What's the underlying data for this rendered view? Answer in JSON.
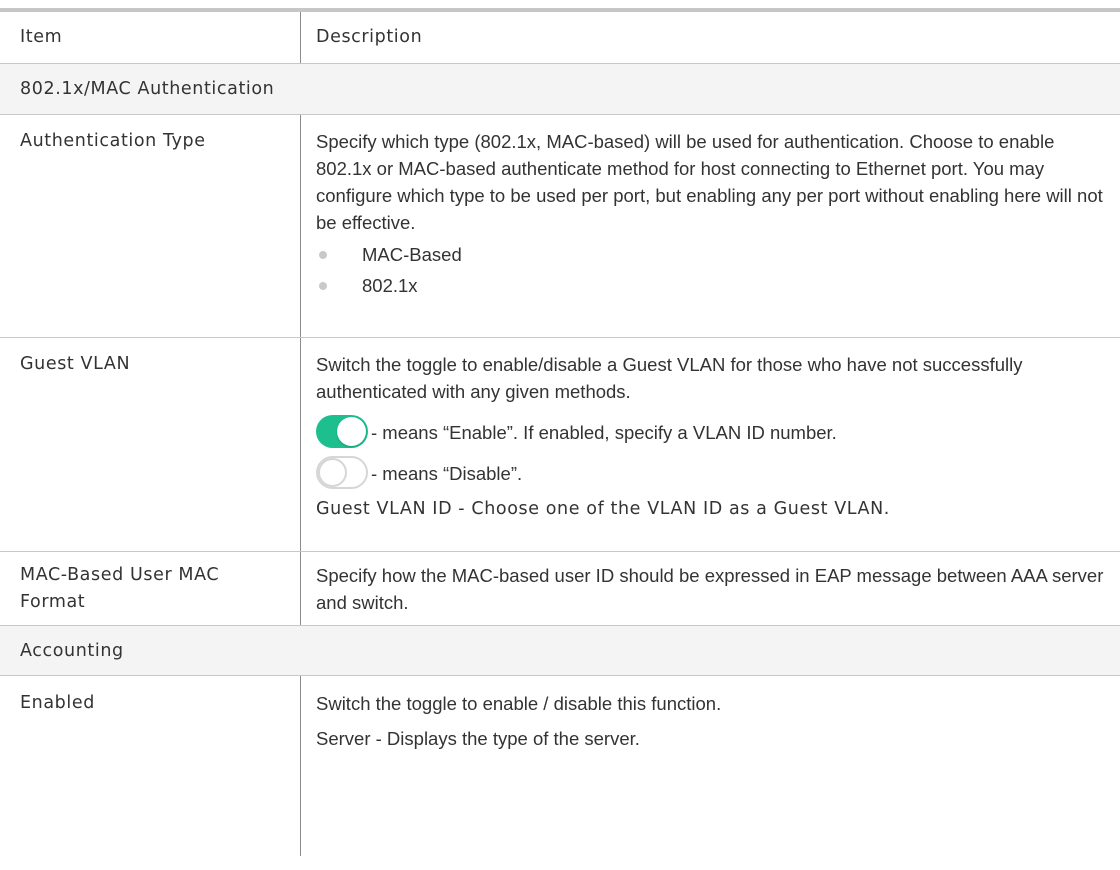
{
  "header": {
    "item": "Item",
    "description": "Description"
  },
  "sections": {
    "auth": "802.1x/MAC Authentication",
    "accounting": "Accounting"
  },
  "rows": {
    "auth_type": {
      "item": "Authentication Type",
      "desc": "Specify which type (802.1x, MAC-based) will be used for authentication. Choose to enable 802.1x or MAC-based authenticate method for host connecting to Ethernet port. You may configure which type to be used per port, but enabling any per port without enabling here will not be effective.",
      "bullets": [
        "MAC-Based",
        "802.1x"
      ]
    },
    "guest_vlan": {
      "item": "Guest VLAN",
      "desc": "Switch the toggle to enable/disable a Guest VLAN for those who have not successfully authenticated with any given methods.",
      "toggle_on_text": "- means “Enable”. If enabled, specify a VLAN ID number.",
      "toggle_off_text": "- means “Disable”.",
      "guest_id": "Guest VLAN ID - Choose one of the VLAN ID as a Guest VLAN."
    },
    "mac_format": {
      "item_line1": "MAC-Based User MAC",
      "item_line2": "Format",
      "desc": "Specify how the MAC-based user ID should be expressed in EAP message between AAA server and switch."
    },
    "enabled": {
      "item": "Enabled",
      "desc": "Switch the toggle to enable / disable this function.",
      "server": "Server - Displays the type of the server."
    }
  },
  "colors": {
    "toggle_on": "#1dbf8f",
    "toggle_off_border": "#d6d6d6",
    "header_rule": "#c6c6c6",
    "section_bg": "#f4f4f4"
  }
}
